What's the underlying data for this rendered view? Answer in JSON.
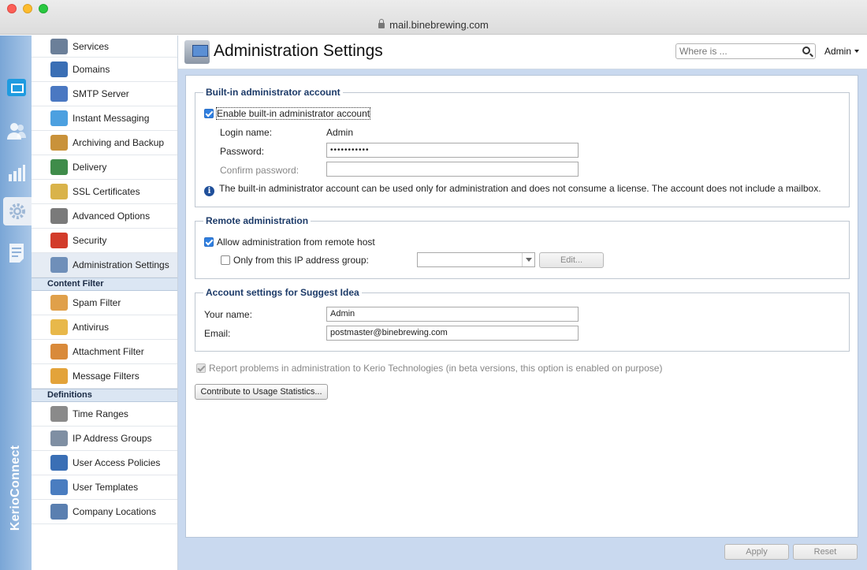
{
  "window": {
    "url": "mail.binebrewing.com"
  },
  "rail": {
    "brand": "KerioConnect",
    "items": [
      {
        "icon": "mail-icon"
      },
      {
        "icon": "people-icon"
      },
      {
        "icon": "stats-icon"
      },
      {
        "icon": "gear-icon",
        "active": true
      },
      {
        "icon": "notes-icon"
      }
    ]
  },
  "sidebar": {
    "items": [
      {
        "label": "Services",
        "icon": "services-icon",
        "color": "#6b7f99"
      },
      {
        "label": "Domains",
        "icon": "at-sign-icon",
        "color": "#3a6fb5"
      },
      {
        "label": "SMTP Server",
        "icon": "smtp-server-icon",
        "color": "#4a78c2"
      },
      {
        "label": "Instant Messaging",
        "icon": "chat-bubbles-icon",
        "color": "#4ca0e0"
      },
      {
        "label": "Archiving and Backup",
        "icon": "archive-box-icon",
        "color": "#c9923a"
      },
      {
        "label": "Delivery",
        "icon": "delivery-icon",
        "color": "#3f8c4a"
      },
      {
        "label": "SSL Certificates",
        "icon": "certificate-icon",
        "color": "#d9b34a"
      },
      {
        "label": "Advanced Options",
        "icon": "gears-icon",
        "color": "#7a7a7a"
      },
      {
        "label": "Security",
        "icon": "stop-hand-icon",
        "color": "#d23b2a"
      },
      {
        "label": "Administration Settings",
        "icon": "admin-settings-icon",
        "color": "#6f8fb9",
        "active": true
      }
    ],
    "content_filter_header": "Content Filter",
    "content_filter_items": [
      {
        "label": "Spam Filter",
        "icon": "spam-filter-icon",
        "color": "#e0a04a"
      },
      {
        "label": "Antivirus",
        "icon": "antivirus-icon",
        "color": "#e8b84a"
      },
      {
        "label": "Attachment Filter",
        "icon": "attachment-filter-icon",
        "color": "#d98a3a"
      },
      {
        "label": "Message Filters",
        "icon": "message-filters-icon",
        "color": "#e3a33a"
      }
    ],
    "definitions_header": "Definitions",
    "definitions_items": [
      {
        "label": "Time Ranges",
        "icon": "time-ranges-icon",
        "color": "#8a8a8a"
      },
      {
        "label": "IP Address Groups",
        "icon": "ip-groups-icon",
        "color": "#7f8fa3"
      },
      {
        "label": "User Access Policies",
        "icon": "user-access-icon",
        "color": "#3a6fb5"
      },
      {
        "label": "User Templates",
        "icon": "user-templates-icon",
        "color": "#4a7dc0"
      },
      {
        "label": "Company Locations",
        "icon": "company-locations-icon",
        "color": "#5a7fb0"
      }
    ]
  },
  "header": {
    "title": "Administration Settings",
    "search_placeholder": "Where is ...",
    "user": "Admin"
  },
  "builtin": {
    "legend": "Built-in administrator account",
    "enable_label": "Enable built-in administrator account",
    "login_label": "Login name:",
    "login_value": "Admin",
    "password_label": "Password:",
    "password_value": "•••••••••••",
    "confirm_label": "Confirm password:",
    "confirm_value": "",
    "info_text": "The built-in administrator account can be used only for administration and does not consume a license. The account does not include a mailbox."
  },
  "remote": {
    "legend": "Remote administration",
    "allow_label": "Allow administration from remote host",
    "only_label": "Only from this IP address group:",
    "group_value": "",
    "edit_label": "Edit..."
  },
  "suggest": {
    "legend": "Account settings for Suggest Idea",
    "name_label": "Your name:",
    "name_value": "Admin",
    "email_label": "Email:",
    "email_value": "postmaster@binebrewing.com"
  },
  "report_label": "Report problems in administration to Kerio Technologies (in beta versions, this option is enabled on purpose)",
  "contribute_label": "Contribute to Usage Statistics...",
  "footer": {
    "apply_label": "Apply",
    "reset_label": "Reset"
  }
}
